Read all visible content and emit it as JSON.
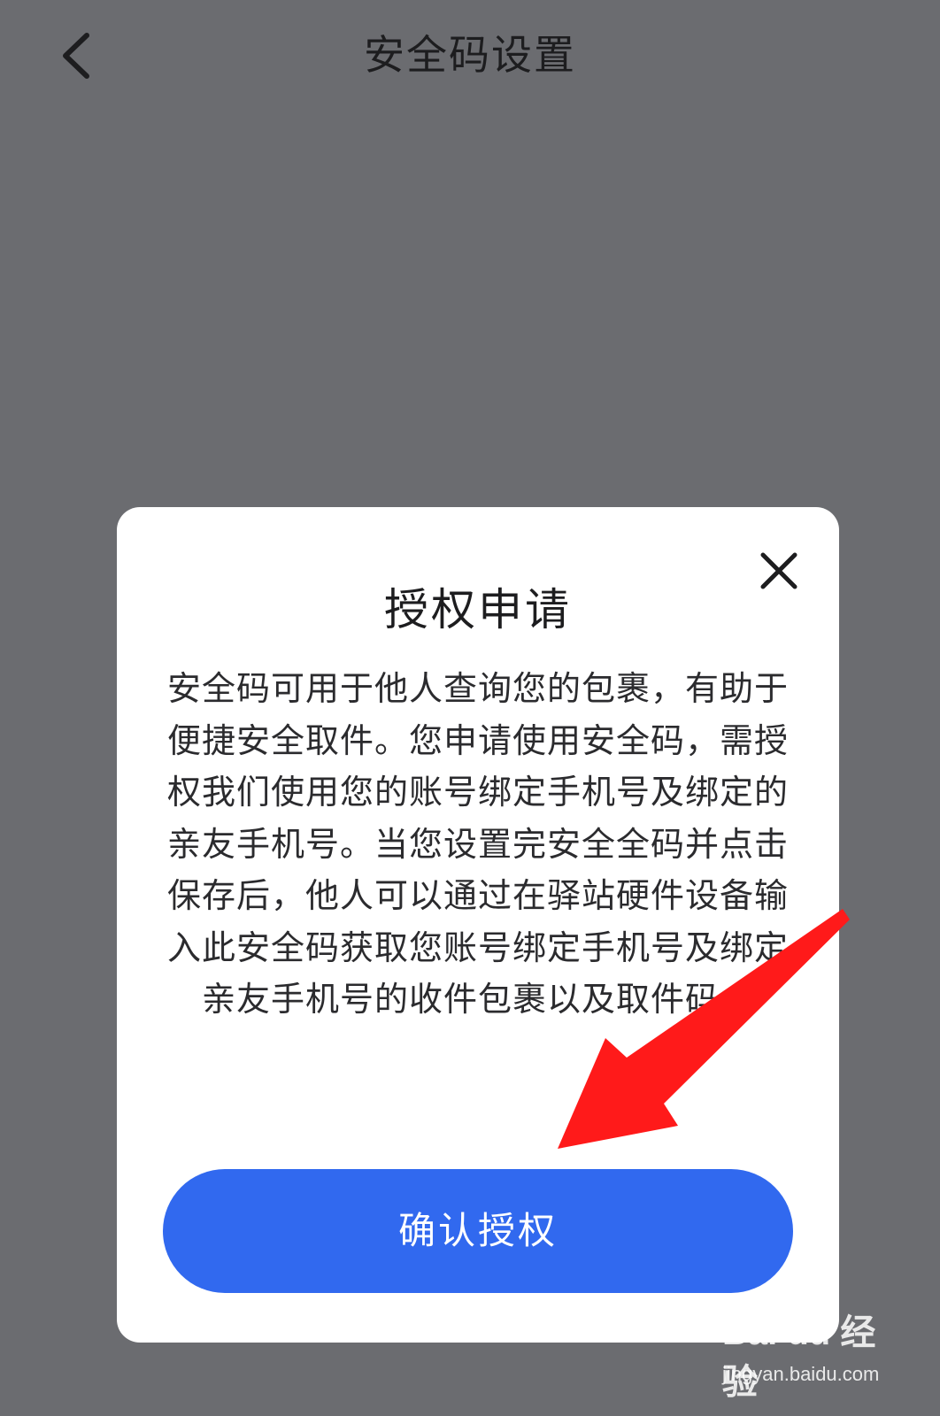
{
  "nav": {
    "title": "安全码设置",
    "back_icon": "chevron-left-icon"
  },
  "dialog": {
    "title": "授权申请",
    "close_icon": "close-icon",
    "body": "安全码可用于他人查询您的包裹，有助于便捷安全取件。您申请使用安全码，需授权我们使用您的账号绑定手机号及绑定的亲友手机号。当您设置完安全全码并点击保存后，他人可以通过在驿站硬件设备输入此安全码获取您账号绑定手机号及绑定亲友手机号的收件包裹以及取件码。",
    "confirm_label": "确认授权"
  },
  "annotation": {
    "arrow_color": "#ff1a1a"
  },
  "watermark": {
    "logo": "Bai du 经验",
    "url": "jingyan.baidu.com"
  },
  "colors": {
    "overlay_background": "#6b6c70",
    "dialog_background": "#ffffff",
    "primary_button": "#3169ef"
  }
}
